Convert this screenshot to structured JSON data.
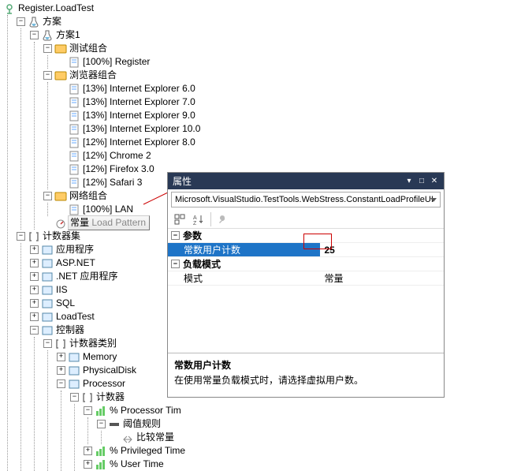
{
  "root": {
    "label": "Register.LoadTest",
    "plan": {
      "label": "方案",
      "plan1": {
        "label": "方案1",
        "testMix": {
          "label": "测试组合",
          "item": "[100%] Register"
        },
        "browserMix": {
          "label": "浏览器组合",
          "items": [
            "[13%] Internet Explorer 6.0",
            "[13%] Internet Explorer 7.0",
            "[13%] Internet Explorer 9.0",
            "[13%] Internet Explorer 10.0",
            "[12%] Internet Explorer 8.0",
            "[12%] Chrome 2",
            "[12%] Firefox 3.0",
            "[12%] Safari 3"
          ]
        },
        "netMix": {
          "label": "网络组合",
          "item": "[100%] LAN"
        },
        "loadPattern": {
          "prefix": "常量",
          "suffix": " Load Pattern"
        }
      }
    },
    "counters": {
      "label": "计数器集",
      "items": [
        "应用程序",
        "ASP.NET",
        ".NET 应用程序",
        "IIS",
        "SQL",
        "LoadTest"
      ],
      "controller": {
        "label": "控制器",
        "category": {
          "label": "计数器类别",
          "items": [
            "Memory",
            "PhysicalDisk"
          ],
          "processor": {
            "label": "Processor",
            "counters": {
              "label": "计数器",
              "proc": {
                "label": "% Processor Tim",
                "threshold": {
                  "label": "阈值规则",
                  "item": "比较常量"
                }
              },
              "rest": [
                "% Privileged Time",
                "% User Time"
              ]
            }
          }
        }
      }
    }
  },
  "panel": {
    "title": "属性",
    "dropdown": "Microsoft.VisualStudio.TestTools.WebStress.ConstantLoadProfileUI",
    "cat1": "参数",
    "prop1_name": "常数用户计数",
    "prop1_val": "25",
    "cat2": "负载模式",
    "prop2_name": "模式",
    "prop2_val": "常量",
    "help_title": "常数用户计数",
    "help_text": "在使用常量负载模式时，请选择虚拟用户数。"
  }
}
